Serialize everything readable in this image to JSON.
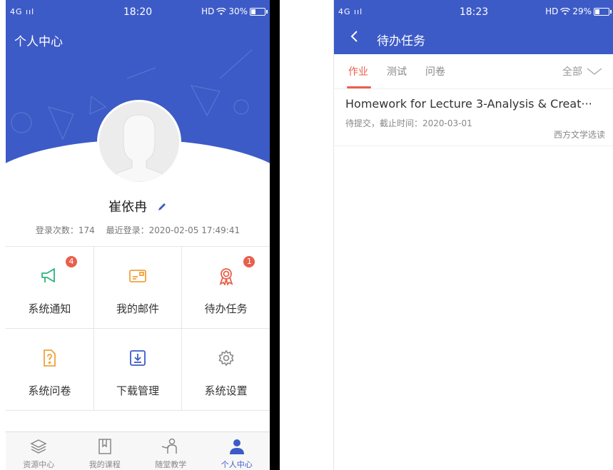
{
  "left": {
    "status": {
      "signal": "4G ııl",
      "time": "18:20",
      "hd_wifi": "HD",
      "battery": "30%",
      "battery_level": 0.3
    },
    "page_title": "个人中心",
    "user": {
      "name": "崔依冉",
      "login_count": "登录次数：174",
      "last_login": "最近登录：2020-02-05 17:49:41"
    },
    "menu": [
      {
        "label": "系统通知",
        "icon": "megaphone-icon",
        "badge": "4",
        "color": "#2fb37e"
      },
      {
        "label": "我的邮件",
        "icon": "mail-card-icon",
        "badge": "",
        "color": "#f0a23c"
      },
      {
        "label": "待办任务",
        "icon": "award-ribbon-icon",
        "badge": "1",
        "color": "#e8604c"
      },
      {
        "label": "系统问卷",
        "icon": "question-doc-icon",
        "badge": "",
        "color": "#f0a23c"
      },
      {
        "label": "下载管理",
        "icon": "download-icon",
        "badge": "",
        "color": "#3d5bc7"
      },
      {
        "label": "系统设置",
        "icon": "gear-icon",
        "badge": "",
        "color": "#888888"
      }
    ],
    "tabs": [
      {
        "label": "资源中心",
        "icon": "layers-icon"
      },
      {
        "label": "我的课程",
        "icon": "book-icon"
      },
      {
        "label": "随堂教学",
        "icon": "teacher-icon"
      },
      {
        "label": "个人中心",
        "icon": "person-icon"
      }
    ],
    "active_tab": 3
  },
  "right": {
    "status": {
      "signal": "4G ııl",
      "time": "18:23",
      "hd_wifi": "HD",
      "battery": "29%",
      "battery_level": 0.29
    },
    "title": "待办任务",
    "tabs": [
      "作业",
      "测试",
      "问卷"
    ],
    "active_tab": 0,
    "filter": "全部",
    "tasks": [
      {
        "title": "Homework for Lecture 3-Analysis & Creat···",
        "meta": "待提交，截止时间：2020-03-01",
        "course": "西方文学选读"
      }
    ]
  },
  "colors": {
    "primary": "#3d5bc7",
    "accent": "#e8604c"
  }
}
